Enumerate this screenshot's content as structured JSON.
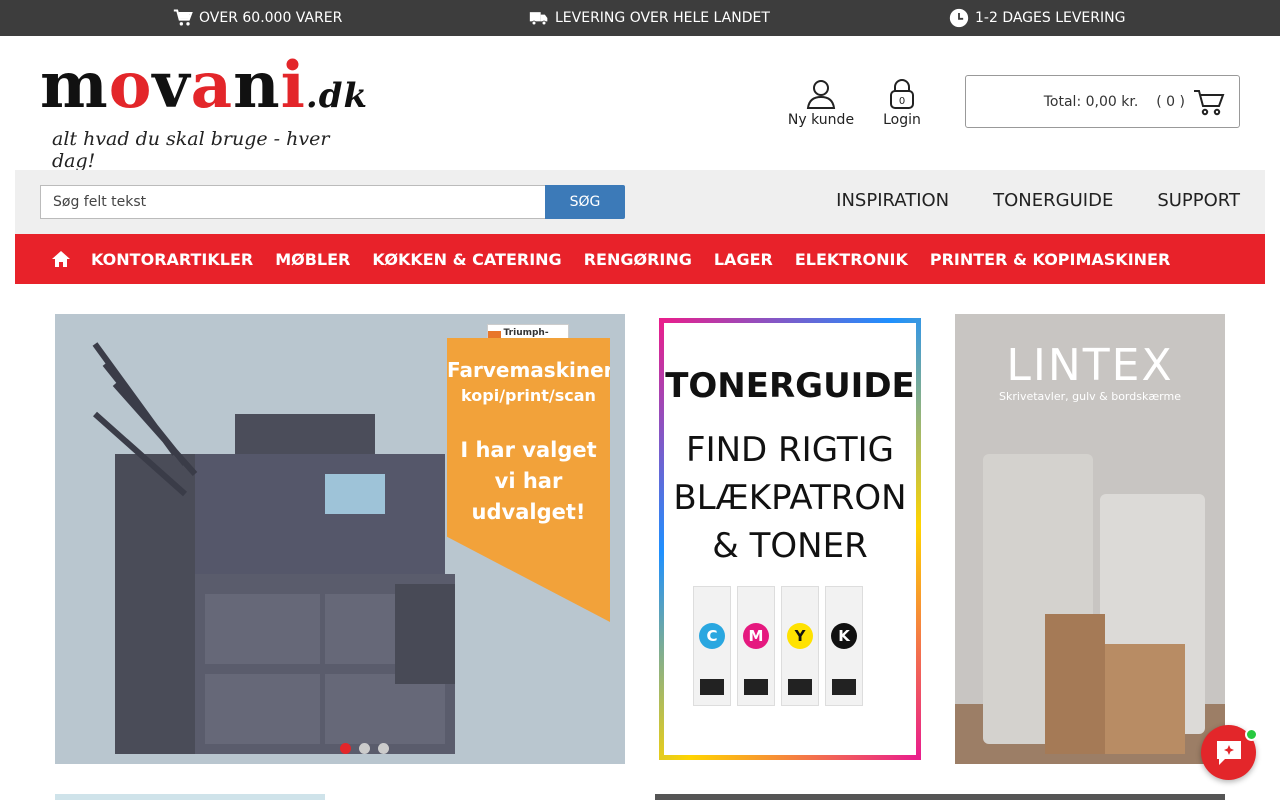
{
  "topbar": {
    "item1": "OVER 60.000 VARER",
    "item2": "LEVERING OVER HELE LANDET",
    "item3": "1-2 DAGES LEVERING"
  },
  "logo": {
    "part1": "m",
    "part2": "o",
    "part3": "v",
    "part4": "a",
    "part5": "n",
    "part6": "i",
    "part7": ".dk",
    "tagline": "alt hvad du skal bruge - hver dag!"
  },
  "header": {
    "new_customer": "Ny kunde",
    "login": "Login",
    "login_badge": "0",
    "cart_total": "Total: 0,00 kr.",
    "cart_count": "( 0 )"
  },
  "search": {
    "placeholder": "Søg felt tekst",
    "button": "SØG",
    "links": [
      "INSPIRATION",
      "TONERGUIDE",
      "SUPPORT"
    ]
  },
  "categories": [
    "KONTORARTIKLER",
    "MØBLER",
    "KØKKEN & CATERING",
    "RENGØRING",
    "LAGER",
    "ELEKTRONIK",
    "PRINTER & KOPIMASKINER"
  ],
  "banner1": {
    "badge": "Triumph-Adler",
    "line1": "Farvemaskiner",
    "line2": "kopi/print/scan",
    "line3": "I har valget",
    "line4": "vi har",
    "line5": "udvalget!"
  },
  "banner2": {
    "title": "TONERGUIDE",
    "sub1": "FIND RIGTIG",
    "sub2": "BLÆKPATRON",
    "sub3": "& TONER",
    "c": "C",
    "m": "M",
    "y": "Y",
    "k": "K"
  },
  "banner3": {
    "logo": "LINTEX",
    "sub": "Skrivetavler, gulv & bordskærme"
  },
  "colors": {
    "brand_red": "#e3262a",
    "search_blue": "#3c7ab8",
    "topbar": "#3d3d3d",
    "orange": "#f2a23a"
  }
}
